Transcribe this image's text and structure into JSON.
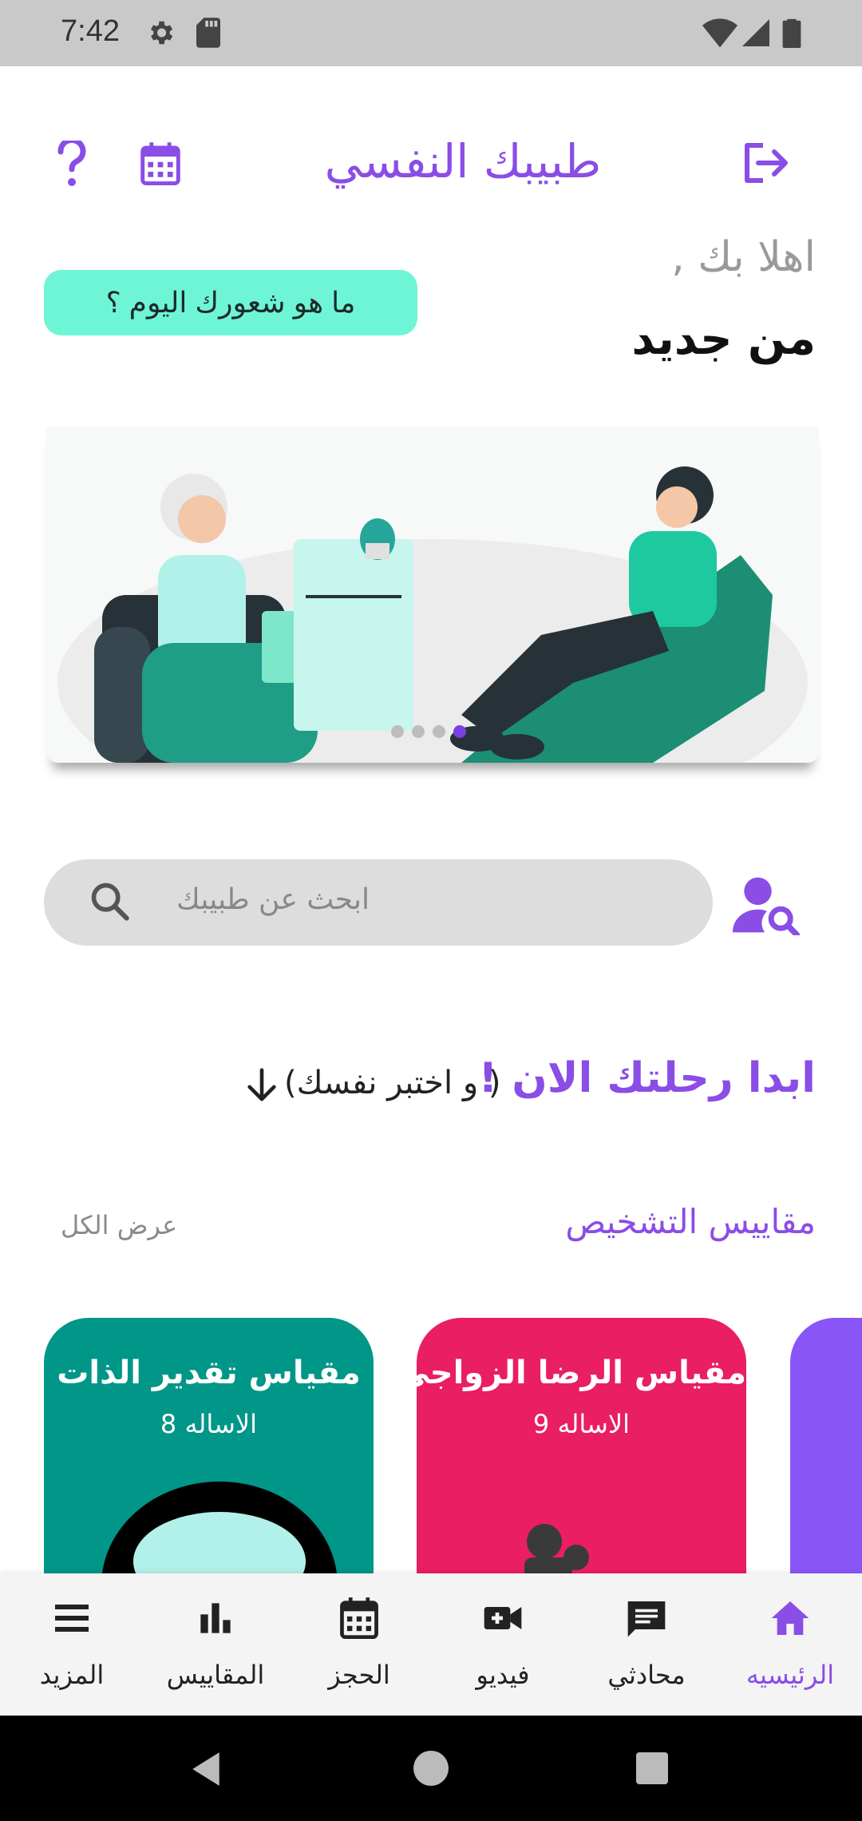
{
  "status_bar": {
    "time": "7:42"
  },
  "header": {
    "title": "طبيبك النفسي",
    "icons": [
      "help-icon",
      "calendar-icon",
      "logout-icon"
    ]
  },
  "greeting": {
    "line1": "اهلا بك ,",
    "line2": "من جديد",
    "mood_button": "ما هو شعورك اليوم ؟"
  },
  "banner": {
    "slides": 4,
    "active_slide": 4
  },
  "search": {
    "placeholder": "ابحث عن طبيبك"
  },
  "journey": {
    "title": "ابدا رحلتك الان !",
    "subtitle": "( و اختبر نفسك)"
  },
  "scales_section": {
    "title": "مقاييس التشخيص",
    "view_all": "عرض الكل",
    "cards": [
      {
        "title": "مقياس تقدير الذات",
        "subtitle": "الاساله 8",
        "color": "#009688"
      },
      {
        "title": "مقياس الرضا الزواجي",
        "subtitle": "الاساله 9",
        "color": "#E91E63"
      },
      {
        "title": "",
        "subtitle": "",
        "color": "#8A55F7"
      }
    ]
  },
  "bottom_nav": {
    "items": [
      {
        "label": "المزيد",
        "icon": "menu-icon"
      },
      {
        "label": "المقاييس",
        "icon": "bar-chart-icon"
      },
      {
        "label": "الحجز",
        "icon": "calendar-icon"
      },
      {
        "label": "فيديو",
        "icon": "video-call-icon"
      },
      {
        "label": "محادثي",
        "icon": "chat-icon"
      },
      {
        "label": "الرئيسيه",
        "icon": "home-icon",
        "active": true
      }
    ]
  },
  "colors": {
    "accent": "#8A4DE6",
    "mood_button": "#6EF5D6",
    "teal": "#009688",
    "pink": "#E91E63"
  }
}
